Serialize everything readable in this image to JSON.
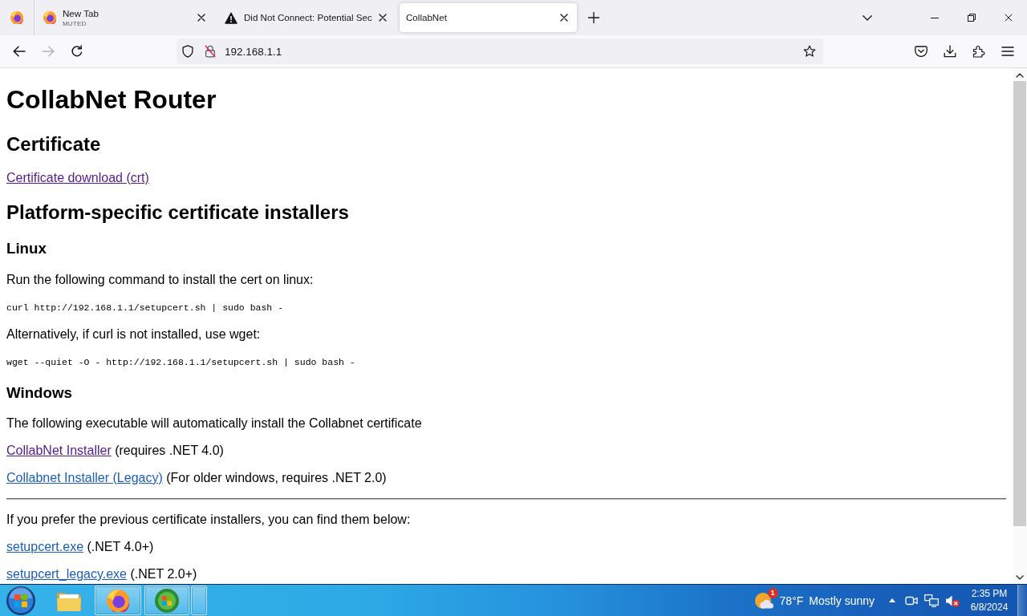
{
  "tabs": [
    {
      "kind": "pinned",
      "selected": false
    },
    {
      "kind": "site",
      "title": "New Tab",
      "subtitle": "MUTED",
      "selected": false
    },
    {
      "kind": "alert",
      "title": "Did Not Connect: Potential Sec",
      "selected": false
    },
    {
      "kind": "plain",
      "title": "CollabNet",
      "selected": true
    }
  ],
  "nav_buttons": [
    {
      "kind": "back",
      "disabled": false
    },
    {
      "kind": "forward",
      "disabled": true
    },
    {
      "kind": "reload",
      "disabled": false
    }
  ],
  "address_bar": {
    "url": "192.168.1.1"
  },
  "page": {
    "blocks": [
      {
        "kind": "h1",
        "text": "CollabNet Router"
      },
      {
        "kind": "h2",
        "text": "Certificate"
      },
      {
        "kind": "link",
        "link": "Certificate download (crt)",
        "visited": true
      },
      {
        "kind": "h2",
        "text": "Platform-specific certificate installers"
      },
      {
        "kind": "h3",
        "text": "Linux"
      },
      {
        "kind": "p",
        "text": "Run the following command to install the cert on linux:"
      },
      {
        "kind": "code",
        "text": "curl http://192.168.1.1/setupcert.sh | sudo bash -"
      },
      {
        "kind": "p",
        "text": "Alternatively, if curl is not installed, use wget:"
      },
      {
        "kind": "code",
        "text": "wget --quiet -O - http://192.168.1.1/setupcert.sh | sudo bash -"
      },
      {
        "kind": "h3",
        "text": "Windows"
      },
      {
        "kind": "p",
        "text": "The following executable will automatically install the Collabnet certificate"
      },
      {
        "kind": "link",
        "link": "CollabNet Installer",
        "visited": true,
        "note": "(requires .NET 4.0)"
      },
      {
        "kind": "link",
        "link": "Collabnet Installer (Legacy)",
        "visited": false,
        "note": "(For older windows, requires .NET 2.0)"
      },
      {
        "kind": "rule"
      },
      {
        "kind": "p",
        "text": "If you prefer the previous certificate installers, you can find them below:"
      },
      {
        "kind": "link",
        "link": "setupcert.exe",
        "visited": false,
        "note": "(.NET 4.0+)"
      },
      {
        "kind": "link",
        "link": "setupcert_legacy.exe",
        "visited": false,
        "note": "(.NET 2.0+)"
      }
    ]
  },
  "taskbar": {
    "apps": [
      {
        "kind": "folder",
        "running": false
      },
      {
        "kind": "browser",
        "running": true
      },
      {
        "kind": "orb",
        "running": true
      },
      {
        "kind": "blank",
        "running": true
      }
    ],
    "tray": {
      "badge": "1",
      "temperature": "78°F",
      "conditions": "Mostly sunny",
      "volume_muted": true,
      "time": "2:35 PM",
      "date": "6/8/2024"
    }
  }
}
